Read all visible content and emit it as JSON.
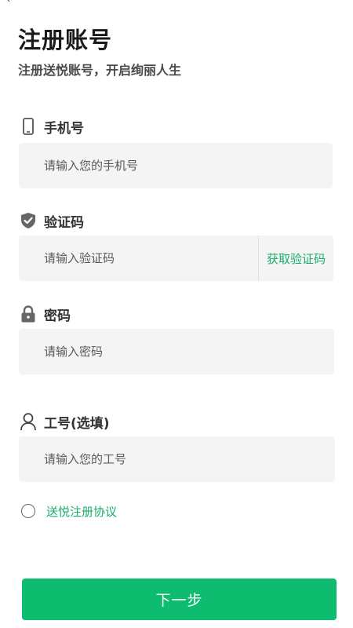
{
  "header": {
    "title": "注册账号",
    "subtitle": "注册送悦账号，开启绚丽人生"
  },
  "fields": {
    "phone": {
      "label": "手机号",
      "placeholder": "请输入您的手机号",
      "value": ""
    },
    "code": {
      "label": "验证码",
      "placeholder": "请输入验证码",
      "value": "",
      "button_label": "获取验证码"
    },
    "password": {
      "label": "密码",
      "placeholder": "请输入密码",
      "value": ""
    },
    "employee_id": {
      "label": "工号(选填)",
      "placeholder": "请输入您的工号",
      "value": ""
    }
  },
  "agreement": {
    "link_label": "送悦注册协议",
    "checked": false
  },
  "footer": {
    "next_label": "下一步"
  },
  "colors": {
    "accent": "#0ebc6f",
    "link": "#1aad6a",
    "input_bg": "#f4f4f4"
  },
  "icons": {
    "phone": "phone-icon",
    "code": "shield-check-icon",
    "password": "lock-icon",
    "employee_id": "user-icon"
  }
}
